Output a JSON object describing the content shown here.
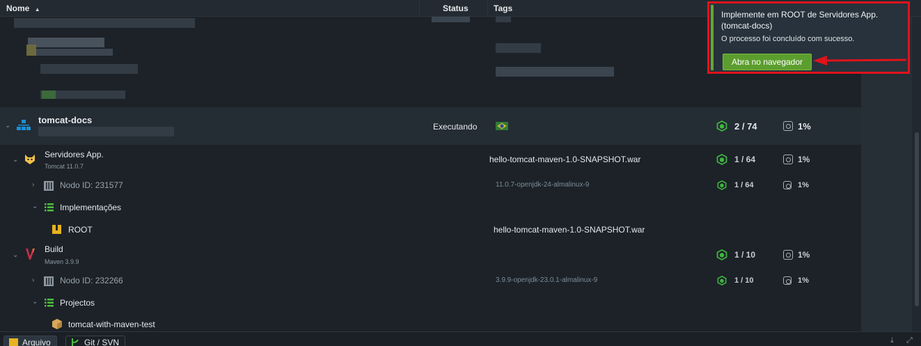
{
  "header": {
    "name_label": "Nome",
    "status_label": "Status",
    "tags_label": "Tags"
  },
  "env": {
    "name": "tomcat-docs",
    "status": "Executando",
    "cloudlets": "2 / 74",
    "disk": "1%"
  },
  "app_servers": {
    "name": "Servidores App.",
    "version": "Tomcat 11.0.7",
    "tag": "hello-tomcat-maven-1.0-SNAPSHOT.war",
    "cloudlets": "1 / 64",
    "disk": "1%",
    "node": {
      "label": "Nodo ID: 231577",
      "tag": "11.0.7-openjdk-24-almalinux-9",
      "cloudlets": "1 / 64",
      "disk": "1%"
    },
    "deployments": {
      "label": "Implementações"
    },
    "root": {
      "label": "ROOT",
      "tag": "hello-tomcat-maven-1.0-SNAPSHOT.war"
    }
  },
  "build": {
    "name": "Build",
    "version": "Maven 3.9.9",
    "cloudlets": "1 / 10",
    "disk": "1%",
    "node": {
      "label": "Nodo ID: 232266",
      "tag": "3.9.9-openjdk-23.0.1-almalinux-9",
      "cloudlets": "1 / 10",
      "disk": "1%"
    },
    "projects": {
      "label": "Projectos"
    },
    "project": {
      "label": "tomcat-with-maven-test"
    }
  },
  "footer": {
    "tab1": "Arquivo",
    "tab2": "Git / SVN"
  },
  "toast": {
    "title": "Implemente em ROOT de Servidores App. (tomcat-docs)",
    "message": "O processo foi concluído com sucesso.",
    "button": "Abra no navegador"
  },
  "colors": {
    "accent_green": "#5c9e2e",
    "highlight_red": "#e0131b",
    "bg": "#1c2228"
  },
  "icons": [
    "sort-asc-icon",
    "topology-icon",
    "tomcat-icon",
    "maven-icon",
    "server-node-icon",
    "list-icon",
    "archive-icon",
    "package-icon",
    "cloudlet-hex-icon",
    "disk-gauge-icon",
    "download-icon",
    "expand-icon",
    "git-icon",
    "folder-icon",
    "brazil-flag-icon"
  ]
}
